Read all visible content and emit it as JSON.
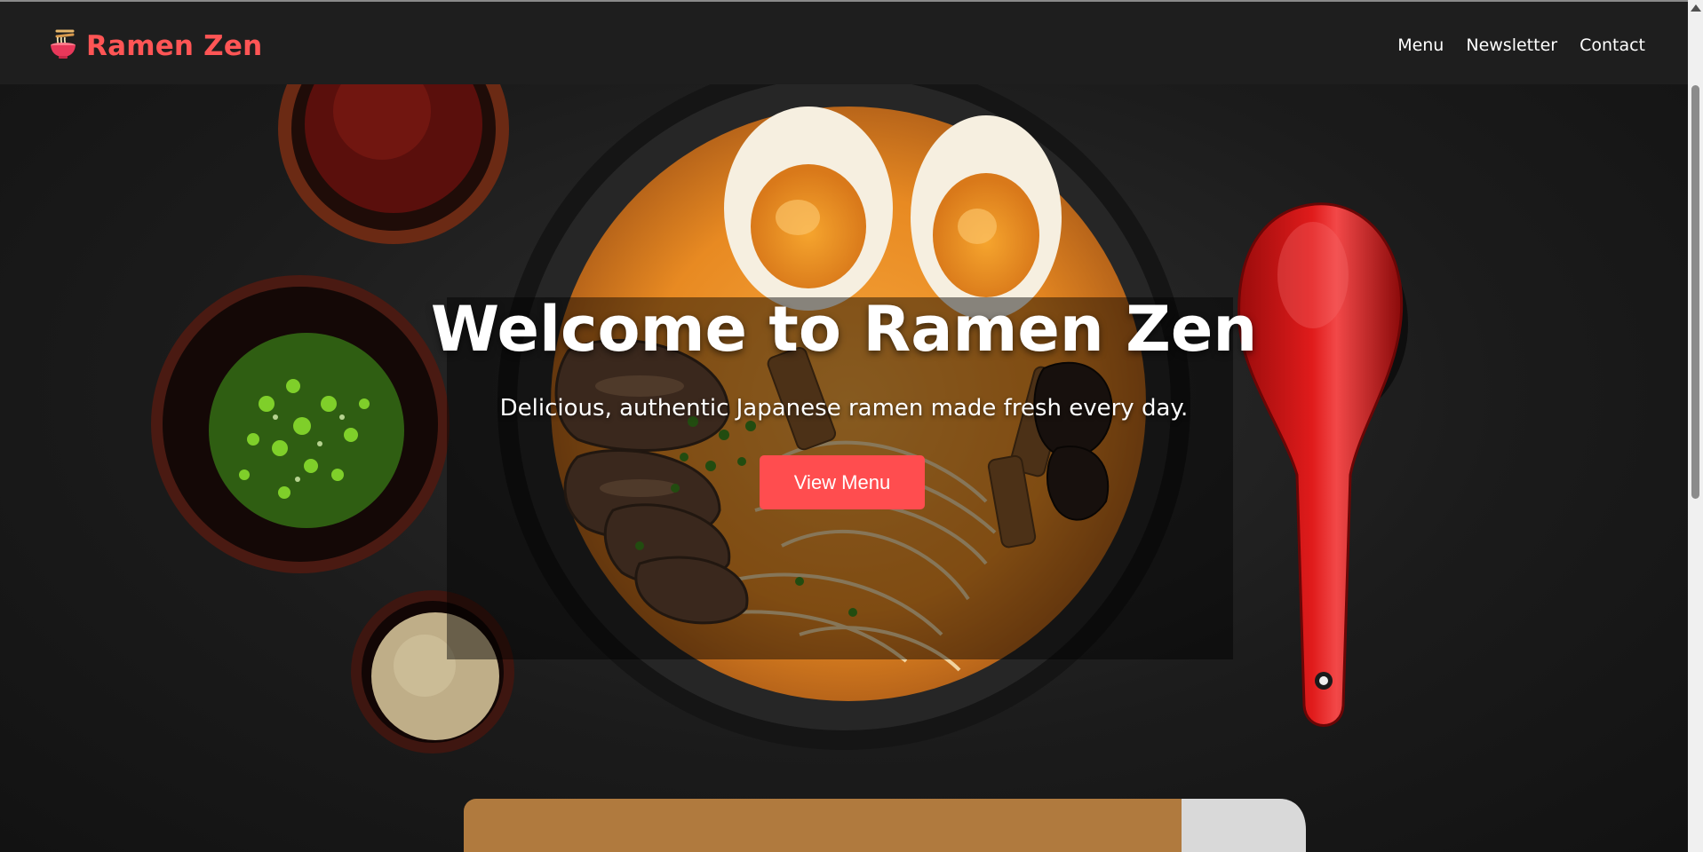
{
  "header": {
    "brand_icon": "ramen-bowl-icon",
    "brand_title": "Ramen Zen",
    "nav": [
      {
        "label": "Menu"
      },
      {
        "label": "Newsletter"
      },
      {
        "label": "Contact"
      }
    ]
  },
  "hero": {
    "title": "Welcome to Ramen Zen",
    "subtitle": "Delicious, authentic Japanese ramen made fresh every day.",
    "cta_label": "View Menu",
    "image": "ramen-bowl-photo"
  },
  "colors": {
    "accent": "#ff4d4f",
    "brand": "#ff5555",
    "header_bg": "#1e1e1e"
  }
}
